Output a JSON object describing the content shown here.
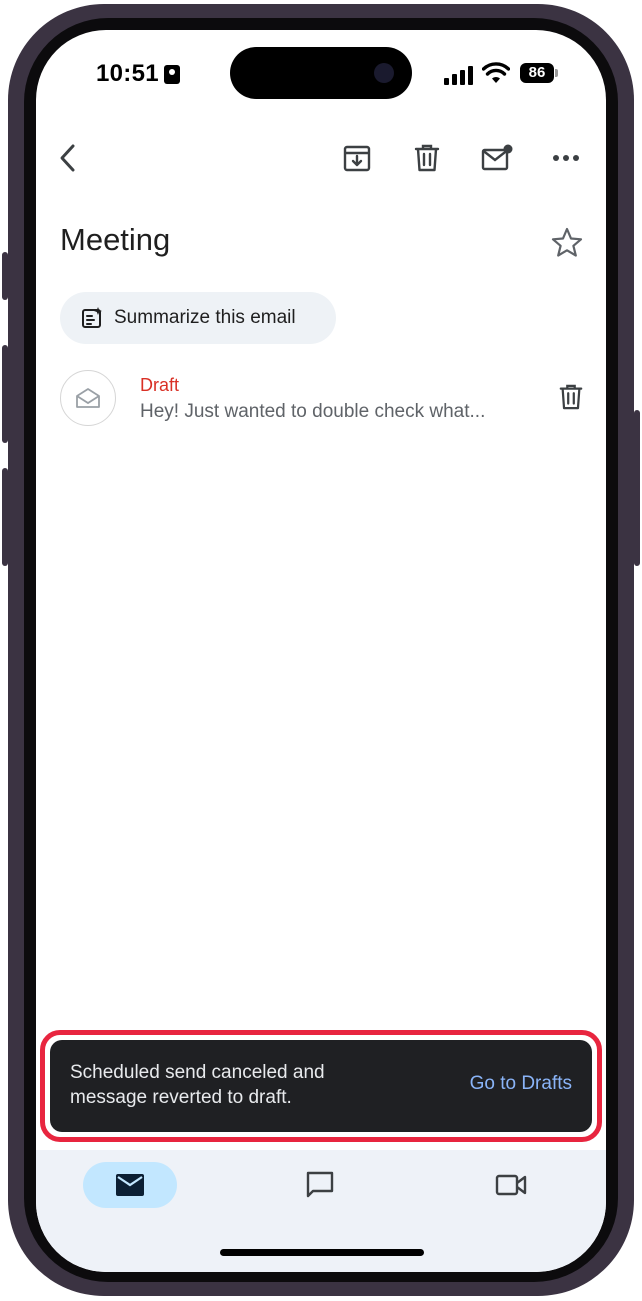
{
  "status_bar": {
    "time": "10:51",
    "battery": "86"
  },
  "toolbar": {
    "back_icon": "chevron-left-icon",
    "archive_icon": "archive-icon",
    "delete_icon": "trash-icon",
    "mark_unread_icon": "mail-unread-icon",
    "more_icon": "more-horizontal-icon"
  },
  "email": {
    "subject": "Meeting",
    "summarize_label": "Summarize this email",
    "thread": {
      "label": "Draft",
      "snippet": "Hey! Just wanted to double check what..."
    }
  },
  "snackbar": {
    "message": "Scheduled send canceled and message reverted to draft.",
    "action": "Go to Drafts"
  },
  "bottom_nav": {
    "items": [
      {
        "icon": "mail-icon",
        "active": true
      },
      {
        "icon": "chat-icon",
        "active": false
      },
      {
        "icon": "video-icon",
        "active": false
      }
    ]
  },
  "colors": {
    "draft_red": "#d93025",
    "snackbar_bg": "#1f2023",
    "snackbar_action": "#8ab4f8",
    "highlight_outline": "#e8253f",
    "nav_active_pill": "#c2e7ff"
  }
}
